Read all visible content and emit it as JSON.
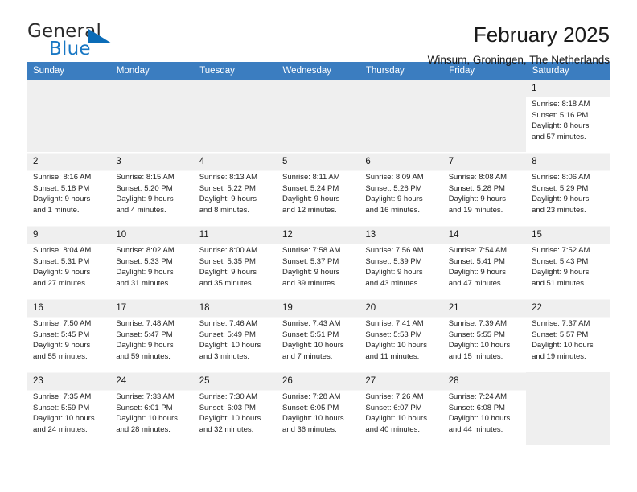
{
  "brand": {
    "word_general": "General",
    "word_blue": "Blue",
    "flag_icon": "triangle-flag-icon"
  },
  "header": {
    "month_title": "February 2025",
    "location": "Winsum, Groningen, The Netherlands"
  },
  "calendar": {
    "weekday_headers": [
      "Sunday",
      "Monday",
      "Tuesday",
      "Wednesday",
      "Thursday",
      "Friday",
      "Saturday"
    ],
    "header_bg": "#3b7dc0",
    "cell_header_bg": "#efefef",
    "labels": {
      "sunrise": "Sunrise:",
      "sunset": "Sunset:",
      "daylight": "Daylight:"
    },
    "weeks": [
      [
        {
          "day": "",
          "empty": true
        },
        {
          "day": "",
          "empty": true
        },
        {
          "day": "",
          "empty": true
        },
        {
          "day": "",
          "empty": true
        },
        {
          "day": "",
          "empty": true
        },
        {
          "day": "",
          "empty": true
        },
        {
          "day": "1",
          "sunrise": "Sunrise: 8:18 AM",
          "sunset": "Sunset: 5:16 PM",
          "daylight1": "Daylight: 8 hours",
          "daylight2": "and 57 minutes."
        }
      ],
      [
        {
          "day": "2",
          "sunrise": "Sunrise: 8:16 AM",
          "sunset": "Sunset: 5:18 PM",
          "daylight1": "Daylight: 9 hours",
          "daylight2": "and 1 minute."
        },
        {
          "day": "3",
          "sunrise": "Sunrise: 8:15 AM",
          "sunset": "Sunset: 5:20 PM",
          "daylight1": "Daylight: 9 hours",
          "daylight2": "and 4 minutes."
        },
        {
          "day": "4",
          "sunrise": "Sunrise: 8:13 AM",
          "sunset": "Sunset: 5:22 PM",
          "daylight1": "Daylight: 9 hours",
          "daylight2": "and 8 minutes."
        },
        {
          "day": "5",
          "sunrise": "Sunrise: 8:11 AM",
          "sunset": "Sunset: 5:24 PM",
          "daylight1": "Daylight: 9 hours",
          "daylight2": "and 12 minutes."
        },
        {
          "day": "6",
          "sunrise": "Sunrise: 8:09 AM",
          "sunset": "Sunset: 5:26 PM",
          "daylight1": "Daylight: 9 hours",
          "daylight2": "and 16 minutes."
        },
        {
          "day": "7",
          "sunrise": "Sunrise: 8:08 AM",
          "sunset": "Sunset: 5:28 PM",
          "daylight1": "Daylight: 9 hours",
          "daylight2": "and 19 minutes."
        },
        {
          "day": "8",
          "sunrise": "Sunrise: 8:06 AM",
          "sunset": "Sunset: 5:29 PM",
          "daylight1": "Daylight: 9 hours",
          "daylight2": "and 23 minutes."
        }
      ],
      [
        {
          "day": "9",
          "sunrise": "Sunrise: 8:04 AM",
          "sunset": "Sunset: 5:31 PM",
          "daylight1": "Daylight: 9 hours",
          "daylight2": "and 27 minutes."
        },
        {
          "day": "10",
          "sunrise": "Sunrise: 8:02 AM",
          "sunset": "Sunset: 5:33 PM",
          "daylight1": "Daylight: 9 hours",
          "daylight2": "and 31 minutes."
        },
        {
          "day": "11",
          "sunrise": "Sunrise: 8:00 AM",
          "sunset": "Sunset: 5:35 PM",
          "daylight1": "Daylight: 9 hours",
          "daylight2": "and 35 minutes."
        },
        {
          "day": "12",
          "sunrise": "Sunrise: 7:58 AM",
          "sunset": "Sunset: 5:37 PM",
          "daylight1": "Daylight: 9 hours",
          "daylight2": "and 39 minutes."
        },
        {
          "day": "13",
          "sunrise": "Sunrise: 7:56 AM",
          "sunset": "Sunset: 5:39 PM",
          "daylight1": "Daylight: 9 hours",
          "daylight2": "and 43 minutes."
        },
        {
          "day": "14",
          "sunrise": "Sunrise: 7:54 AM",
          "sunset": "Sunset: 5:41 PM",
          "daylight1": "Daylight: 9 hours",
          "daylight2": "and 47 minutes."
        },
        {
          "day": "15",
          "sunrise": "Sunrise: 7:52 AM",
          "sunset": "Sunset: 5:43 PM",
          "daylight1": "Daylight: 9 hours",
          "daylight2": "and 51 minutes."
        }
      ],
      [
        {
          "day": "16",
          "sunrise": "Sunrise: 7:50 AM",
          "sunset": "Sunset: 5:45 PM",
          "daylight1": "Daylight: 9 hours",
          "daylight2": "and 55 minutes."
        },
        {
          "day": "17",
          "sunrise": "Sunrise: 7:48 AM",
          "sunset": "Sunset: 5:47 PM",
          "daylight1": "Daylight: 9 hours",
          "daylight2": "and 59 minutes."
        },
        {
          "day": "18",
          "sunrise": "Sunrise: 7:46 AM",
          "sunset": "Sunset: 5:49 PM",
          "daylight1": "Daylight: 10 hours",
          "daylight2": "and 3 minutes."
        },
        {
          "day": "19",
          "sunrise": "Sunrise: 7:43 AM",
          "sunset": "Sunset: 5:51 PM",
          "daylight1": "Daylight: 10 hours",
          "daylight2": "and 7 minutes."
        },
        {
          "day": "20",
          "sunrise": "Sunrise: 7:41 AM",
          "sunset": "Sunset: 5:53 PM",
          "daylight1": "Daylight: 10 hours",
          "daylight2": "and 11 minutes."
        },
        {
          "day": "21",
          "sunrise": "Sunrise: 7:39 AM",
          "sunset": "Sunset: 5:55 PM",
          "daylight1": "Daylight: 10 hours",
          "daylight2": "and 15 minutes."
        },
        {
          "day": "22",
          "sunrise": "Sunrise: 7:37 AM",
          "sunset": "Sunset: 5:57 PM",
          "daylight1": "Daylight: 10 hours",
          "daylight2": "and 19 minutes."
        }
      ],
      [
        {
          "day": "23",
          "sunrise": "Sunrise: 7:35 AM",
          "sunset": "Sunset: 5:59 PM",
          "daylight1": "Daylight: 10 hours",
          "daylight2": "and 24 minutes."
        },
        {
          "day": "24",
          "sunrise": "Sunrise: 7:33 AM",
          "sunset": "Sunset: 6:01 PM",
          "daylight1": "Daylight: 10 hours",
          "daylight2": "and 28 minutes."
        },
        {
          "day": "25",
          "sunrise": "Sunrise: 7:30 AM",
          "sunset": "Sunset: 6:03 PM",
          "daylight1": "Daylight: 10 hours",
          "daylight2": "and 32 minutes."
        },
        {
          "day": "26",
          "sunrise": "Sunrise: 7:28 AM",
          "sunset": "Sunset: 6:05 PM",
          "daylight1": "Daylight: 10 hours",
          "daylight2": "and 36 minutes."
        },
        {
          "day": "27",
          "sunrise": "Sunrise: 7:26 AM",
          "sunset": "Sunset: 6:07 PM",
          "daylight1": "Daylight: 10 hours",
          "daylight2": "and 40 minutes."
        },
        {
          "day": "28",
          "sunrise": "Sunrise: 7:24 AM",
          "sunset": "Sunset: 6:08 PM",
          "daylight1": "Daylight: 10 hours",
          "daylight2": "and 44 minutes."
        },
        {
          "day": "",
          "empty": true
        }
      ]
    ]
  }
}
